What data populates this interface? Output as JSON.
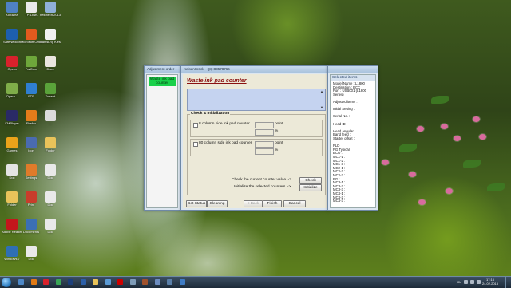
{
  "desktop_icons": [
    {
      "label": "Корзина",
      "color": "#4f82c4"
    },
    {
      "label": "TP-LINK",
      "color": "#eaeaea"
    },
    {
      "label": "hellotech 2013-0-24",
      "color": "#8fb0d8"
    },
    {
      "label": "SafeNetIcon",
      "color": "#1d5fae"
    },
    {
      "label": "Microsoft Office",
      "color": "#e35a1e"
    },
    {
      "label": "Samsung Kies",
      "color": "#f1f1f1"
    },
    {
      "label": "Opera",
      "color": "#d8222c"
    },
    {
      "label": "FurCom",
      "color": "#6ea73b"
    },
    {
      "label": "Docs",
      "color": "#e9e6df"
    },
    {
      "label": "Opera...",
      "color": "#7fae49"
    },
    {
      "label": "FTP",
      "color": "#2f7fd1"
    },
    {
      "label": "Torrent",
      "color": "#5aa33a"
    },
    {
      "label": "KMPlayer",
      "color": "#2a2a66"
    },
    {
      "label": "Firefox",
      "color": "#e47c1a"
    },
    {
      "label": "...",
      "color": "#dbdbdb"
    },
    {
      "label": "Games",
      "color": "#eaa31a"
    },
    {
      "label": "Icon",
      "color": "#4a6bb0"
    },
    {
      "label": "Folder",
      "color": "#e8c35a"
    },
    {
      "label": "Doc",
      "color": "#e4e4e4"
    },
    {
      "label": "Settings",
      "color": "#e07b2a"
    },
    {
      "label": "Doc",
      "color": "#e9e9e9"
    },
    {
      "label": "Folder",
      "color": "#e8c35a"
    },
    {
      "label": "Print",
      "color": "#c83d2b"
    },
    {
      "label": "Doc",
      "color": "#e9e9e9"
    },
    {
      "label": "Adobe Reader",
      "color": "#c4161c"
    },
    {
      "label": "Documents",
      "color": "#3b6fb6"
    },
    {
      "label": "Doc",
      "color": "#e9e9e9"
    },
    {
      "label": "Windows 7",
      "color": "#2f6fb4"
    },
    {
      "label": "Doc",
      "color": "#e9e9e9"
    }
  ],
  "adjustment_window": {
    "title": "Adjustment order",
    "selected_item": "Waste ink pad counter"
  },
  "main_window": {
    "title": "KeisenCrack - QQ:83578766",
    "heading": "Waste ink pad counter",
    "group_title": "Check & Initialization",
    "counters": [
      {
        "label": "8 column side ink pad counter",
        "unit1": "point",
        "unit2": "%"
      },
      {
        "label": "80 column side ink pad counter",
        "unit1": "point",
        "unit2": "%"
      }
    ],
    "hint_check": "Check the current counter value. ->",
    "hint_init": "Initialize the selected counters. ->",
    "buttons": {
      "check": "Check",
      "initialize": "Initialize",
      "get_status": "Get Status",
      "cleaning": "Cleaning",
      "back": "< Back",
      "finish": "Finish",
      "cancel": "Cancel"
    }
  },
  "items_window": {
    "title": "Selected items",
    "lines": [
      "Model Name : L1800",
      "Destination : ECC",
      "Port : USB001 (L1800",
      "Series)",
      "",
      "Adjusted items :",
      "",
      "Initial Setting :",
      "",
      "Serial No. :",
      "",
      "Head ID :",
      "",
      "Head angular",
      "Band feed :",
      "Starter offset :",
      "",
      "PLD",
      "PG Typical",
      "ECO :",
      "MC1-1 :",
      "MC1-2 :",
      "MC1-3 :",
      "MC2-1 :",
      "MC2-2 :",
      "MC2-3 :",
      "PG :",
      "MC3-1 :",
      "MC3-2 :",
      "MC3-3 :",
      "MC4-1 :",
      "MC4-2 :",
      "MC4-3 :"
    ]
  },
  "taskbar": {
    "lang": "RU",
    "time": "17:16",
    "date": "24.02.2015",
    "apps": [
      {
        "name": "explorer",
        "color": "#4d88c7"
      },
      {
        "name": "media-player",
        "color": "#e07a16"
      },
      {
        "name": "opera",
        "color": "#d8222c"
      },
      {
        "name": "chrome",
        "color": "#3aa757"
      },
      {
        "name": "photoshop",
        "color": "#1c3f7a"
      },
      {
        "name": "word",
        "color": "#2b5fa8"
      },
      {
        "name": "folder",
        "color": "#e8c35a"
      },
      {
        "name": "image",
        "color": "#5b9bd5"
      },
      {
        "name": "record",
        "color": "#c00"
      },
      {
        "name": "app",
        "color": "#7f9db9"
      },
      {
        "name": "app2",
        "color": "#a0522d"
      },
      {
        "name": "app3",
        "color": "#6c8cbf"
      },
      {
        "name": "app4",
        "color": "#5a7fa8"
      },
      {
        "name": "app5",
        "color": "#3e7bc4"
      }
    ]
  }
}
